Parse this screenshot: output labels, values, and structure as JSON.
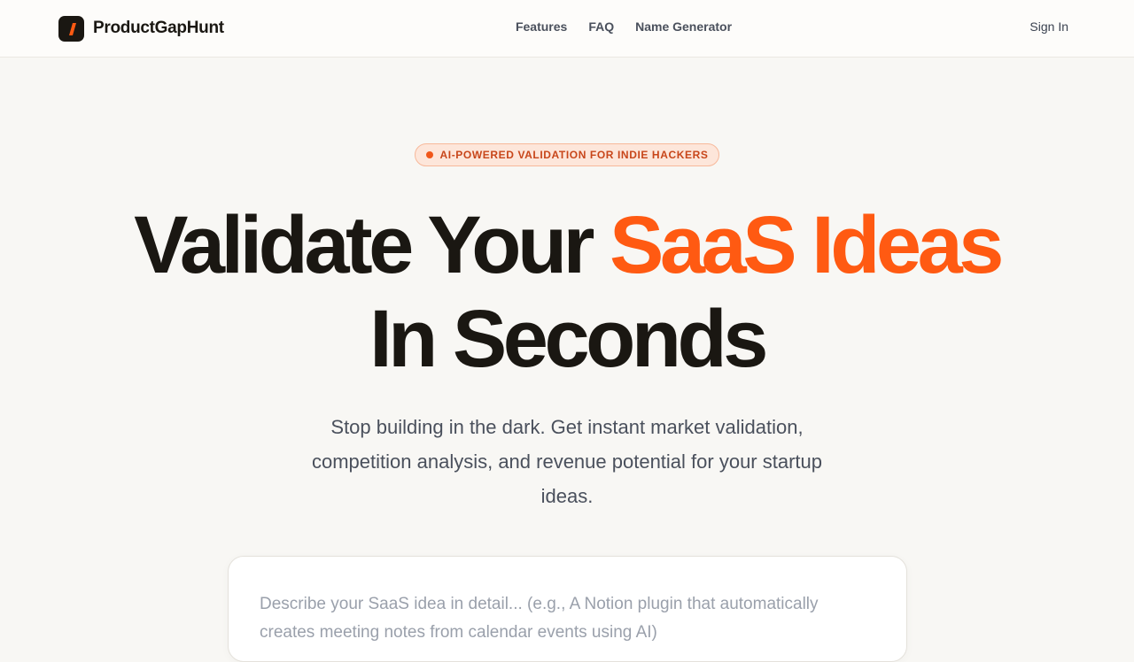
{
  "brand": {
    "name": "ProductGapHunt",
    "logo_icon": "slash-logo-icon",
    "accent": "#ff5a12"
  },
  "nav": [
    {
      "label": "Features"
    },
    {
      "label": "FAQ"
    },
    {
      "label": "Name Generator"
    }
  ],
  "auth": {
    "signin_label": "Sign In"
  },
  "hero": {
    "badge": "AI-POWERED VALIDATION FOR INDIE HACKERS",
    "title_part1": "Validate Your",
    "title_accent": "SaaS Ideas",
    "title_part2": "In Seconds",
    "subtitle": "Stop building in the dark. Get instant market validation, competition analysis, and revenue potential for your startup ideas."
  },
  "idea_form": {
    "placeholder": "Describe your SaaS idea in detail... (e.g., A Notion plugin that automatically creates meeting notes from calendar events using AI)",
    "value": ""
  }
}
